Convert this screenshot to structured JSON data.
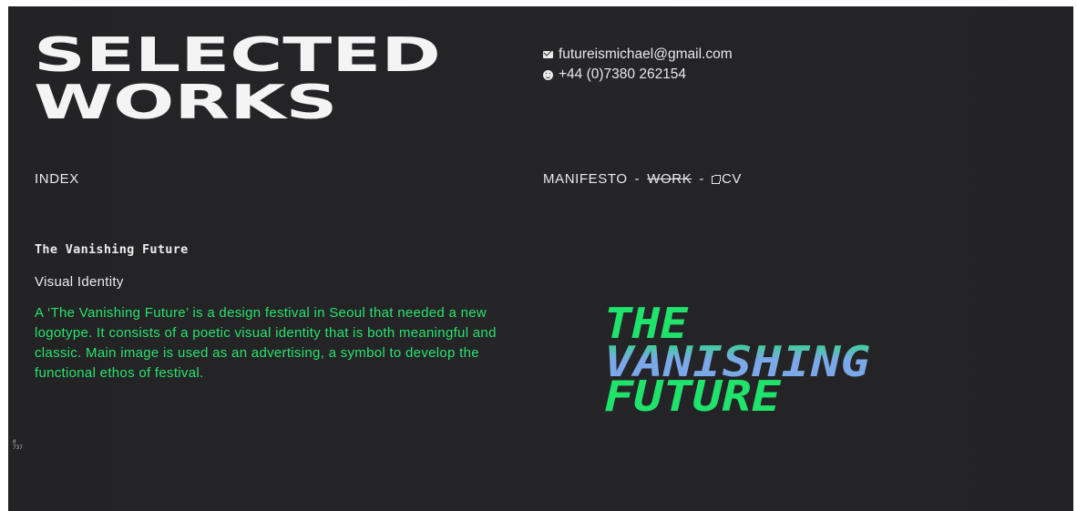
{
  "header": {
    "title_line1": "SELECTED",
    "title_line2": "WORKS"
  },
  "contact": {
    "email": "futureismichael@gmail.com",
    "phone": "+44 (0)7380 262154"
  },
  "nav": {
    "index": "INDEX",
    "manifesto": "MANIFESTO",
    "separator": "-",
    "work": "WORK",
    "cv": "CV"
  },
  "project": {
    "title": "The Vanishing Future",
    "type": "Visual Identity",
    "description": "A ‘The Vanishing Future’ is a design festival in Seoul that needed a new logotype. It consists of a poetic visual identity that is both meaningful and classic. Main image is used as an advertising, a symbol to develop the functional ethos of festival.",
    "logo": {
      "line1": "THE",
      "line2": "VANISHING",
      "line3": "FUTURE",
      "color_green": "#1fe36b",
      "color_blue": "#7aa8e8"
    }
  },
  "corner": {
    "line1": "0",
    "line2": "737"
  },
  "colors": {
    "background": "#232326",
    "accent": "#27e36a",
    "text": "#eaeaea"
  }
}
